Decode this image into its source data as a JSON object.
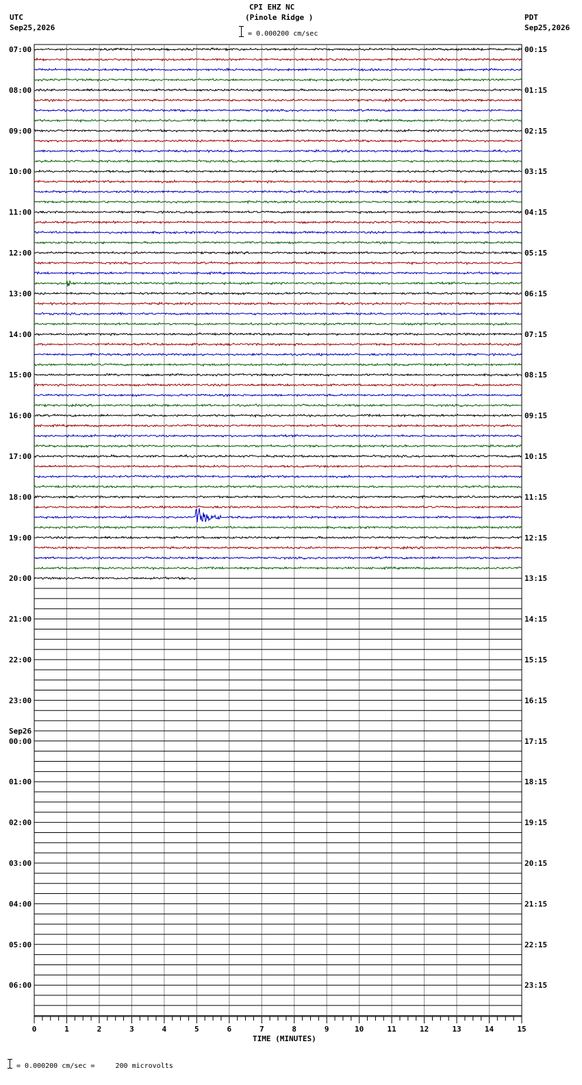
{
  "header": {
    "station": "CPI EHZ NC",
    "location": "(Pinole Ridge )",
    "scale": "= 0.000200 cm/sec",
    "left_tz": "UTC",
    "left_date": "Sep25,2026",
    "right_tz": "PDT",
    "right_date": "Sep25,2026"
  },
  "footer": {
    "scale_note": "= 0.000200 cm/sec =     200 microvolts"
  },
  "chart_data": {
    "type": "line",
    "title": "CPI EHZ NC (Pinole Ridge )",
    "xlabel": "TIME (MINUTES)",
    "xlim": [
      0,
      15
    ],
    "x_ticks": [
      "0",
      "1",
      "2",
      "3",
      "4",
      "5",
      "6",
      "7",
      "8",
      "9",
      "10",
      "11",
      "12",
      "13",
      "14",
      "15"
    ],
    "lines_per_hour": 4,
    "total_lines": 96,
    "trace_colors": [
      "#000000",
      "#a00000",
      "#0000c0",
      "#006000"
    ],
    "left_hour_labels": [
      "07:00",
      "08:00",
      "09:00",
      "10:00",
      "11:00",
      "12:00",
      "13:00",
      "14:00",
      "15:00",
      "16:00",
      "17:00",
      "18:00",
      "19:00",
      "20:00",
      "21:00",
      "22:00",
      "23:00",
      "00:00",
      "01:00",
      "02:00",
      "03:00",
      "04:00",
      "05:00",
      "06:00"
    ],
    "day_change": {
      "hour_index": 17,
      "label": "Sep26"
    },
    "right_hour_labels": [
      "00:15",
      "01:15",
      "02:15",
      "03:15",
      "04:15",
      "05:15",
      "06:15",
      "07:15",
      "08:15",
      "09:15",
      "10:15",
      "11:15",
      "12:15",
      "13:15",
      "14:15",
      "15:15",
      "16:15",
      "17:15",
      "18:15",
      "19:15",
      "20:15",
      "21:15",
      "22:15",
      "23:15"
    ],
    "recorded_full_lines": 52,
    "last_partial_line_minutes": 5,
    "events": [
      {
        "line": 46,
        "minute": 4.95,
        "amplitude": 3.0,
        "duration_min": 0.8
      },
      {
        "line": 23,
        "minute": 1.0,
        "amplitude": 0.7,
        "duration_min": 0.3
      }
    ]
  }
}
